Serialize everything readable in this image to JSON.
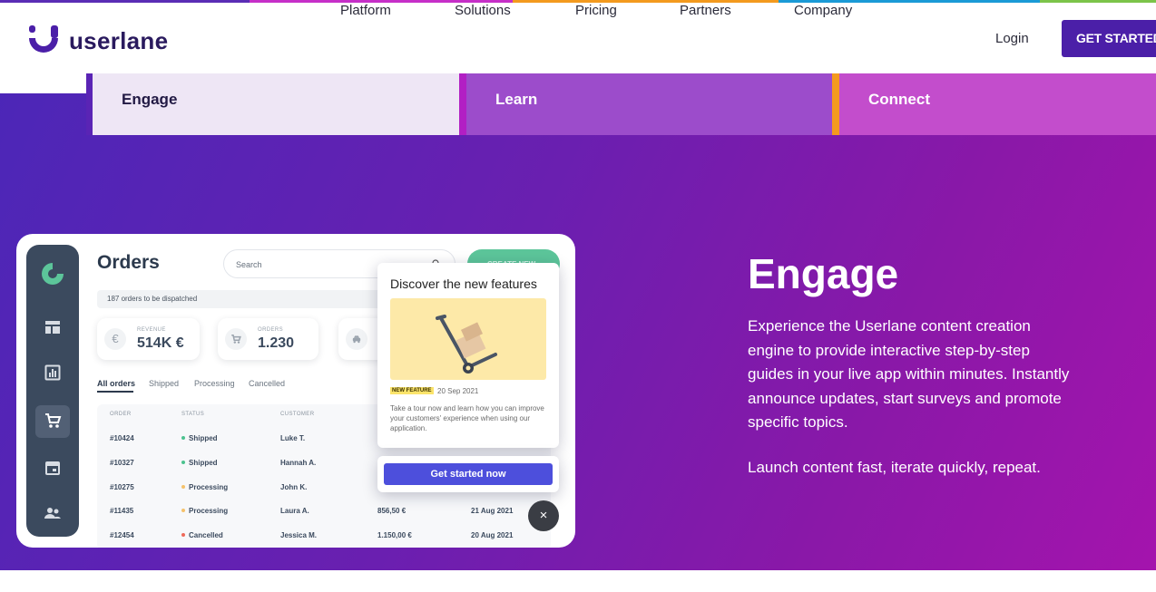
{
  "brand": {
    "name": "userlane",
    "logo_icon": "userlane-logo-icon",
    "accent": "#4b1fa8",
    "strip_colors": [
      "#5a2db5",
      "#c62fc8",
      "#f39a1e",
      "#1a9ad6",
      "#7cc44a"
    ]
  },
  "nav": {
    "items": [
      "Platform",
      "Solutions",
      "Pricing",
      "Partners",
      "Company"
    ],
    "login": "Login",
    "cta": "GET STARTED"
  },
  "tabs": [
    {
      "label": "Engage",
      "active": true
    },
    {
      "label": "Learn",
      "active": false
    },
    {
      "label": "Connect",
      "active": false
    }
  ],
  "hero": {
    "title": "Engage",
    "body": "Experience the Userlane content creation engine to provide interactive step-by-step guides in your live app within minutes. Instantly announce updates, start surveys and promote specific topics.",
    "tagline": "Launch content fast, iterate quickly, repeat."
  },
  "mock_app": {
    "title": "Orders",
    "search_placeholder": "Search",
    "create_button": "CREATE NEW",
    "dispatch_note": "187 orders to be dispatched",
    "stats": [
      {
        "label": "REVENUE",
        "value": "514K €",
        "icon": "euro-icon"
      },
      {
        "label": "ORDERS",
        "value": "1.230",
        "icon": "cart-icon"
      },
      {
        "label": "",
        "value": "",
        "icon": "car-icon"
      }
    ],
    "order_tabs": [
      "All orders",
      "Shipped",
      "Processing",
      "Cancelled"
    ],
    "columns": [
      "ORDER",
      "STATUS",
      "CUSTOMER"
    ],
    "rows": [
      {
        "order": "#10424",
        "status": "Shipped",
        "customer": "Luke T.",
        "amount": "",
        "date": ""
      },
      {
        "order": "#10327",
        "status": "Shipped",
        "customer": "Hannah A.",
        "amount": "",
        "date": ""
      },
      {
        "order": "#10275",
        "status": "Processing",
        "customer": "John K.",
        "amount": "",
        "date": ""
      },
      {
        "order": "#11435",
        "status": "Processing",
        "customer": "Laura A.",
        "amount": "856,50 €",
        "date": "21 Aug 2021"
      },
      {
        "order": "#12454",
        "status": "Cancelled",
        "customer": "Jessica M.",
        "amount": "1.150,00 €",
        "date": "20 Aug 2021"
      }
    ],
    "status_colors": {
      "Shipped": "#4cc28f",
      "Processing": "#f5c26b",
      "Cancelled": "#ee6a5a"
    },
    "sidebar_icons": [
      "dashboard-icon",
      "chart-icon",
      "cart-icon",
      "calendar-icon",
      "people-icon"
    ]
  },
  "popup": {
    "title": "Discover the new features",
    "badge": "NEW FEATURE",
    "date": "20 Sep 2021",
    "text": "Take a tour now and learn how you can improve your customers' experience when using our application.",
    "button": "Get started now",
    "close": "×"
  }
}
